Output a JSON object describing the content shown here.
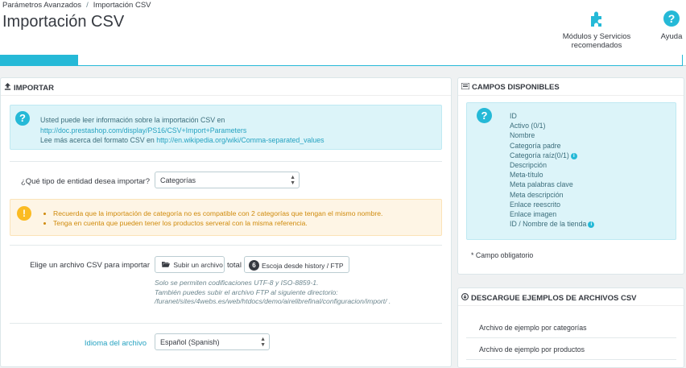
{
  "breadcrumb": {
    "parent": "Parámetros Avanzados",
    "separator": "/",
    "current": "Importación CSV"
  },
  "page_title": "Importación CSV",
  "toolbar": {
    "modules_label": "Módulos y Servicios recomendados",
    "help_label": "Ayuda"
  },
  "import_panel": {
    "title": "IMPORTAR",
    "info": {
      "line1": "Usted puede leer información sobre la importación CSV en",
      "link1": "http://doc.prestashop.com/display/PS16/CSV+Import+Parameters",
      "line3_prefix": "Lee más acerca del formato CSV en",
      "link2": "http://en.wikipedia.org/wiki/Comma-separated_values"
    },
    "entity_label": "¿Qué tipo de entidad desea importar?",
    "entity_value": "Categorías",
    "warnings": [
      "Recuerda que la importación de categoría no es compatible con 2 categorías que tengan el mismo nombre.",
      "Tenga en cuenta que pueden tener los productos serveral con la misma referencia."
    ],
    "file_label": "Elige un archivo CSV para importar",
    "upload_button": "Subir un archivo",
    "total_label": "total",
    "history_count": "6",
    "history_button": "Escoja desde history / FTP",
    "help_lines": [
      "Solo se permiten codificaciones UTF-8 y ISO-8859-1.",
      "También puedes subir el archivo FTP al siguiente directorio:",
      "/furanet/sites/4webs.es/web/htdocs/demo/airelibrefinal/configuracion/import/ ."
    ],
    "language_label": "Idioma del archivo",
    "language_value": "Español (Spanish)"
  },
  "fields_panel": {
    "title": "CAMPOS DISPONIBLES",
    "fields": [
      "ID",
      "Activo (0/1)",
      "Nombre",
      "Categoría padre",
      "Categoría raíz(0/1)",
      "Descripción",
      "Meta-título",
      "Meta palabras clave",
      "Meta descripción",
      "Enlace reescrito",
      "Enlace imagen",
      "ID / Nombre de la tienda"
    ],
    "fields_with_info": [
      4,
      11
    ],
    "required_note": "* Campo obligatorio"
  },
  "download_panel": {
    "title": "DESCARGUE EJEMPLOS DE ARCHIVOS CSV",
    "links": [
      "Archivo de ejemplo por categorías",
      "Archivo de ejemplo por productos"
    ]
  },
  "colors": {
    "accent": "#25b9d7",
    "warning": "#fbbb22",
    "text": "#363a41"
  }
}
